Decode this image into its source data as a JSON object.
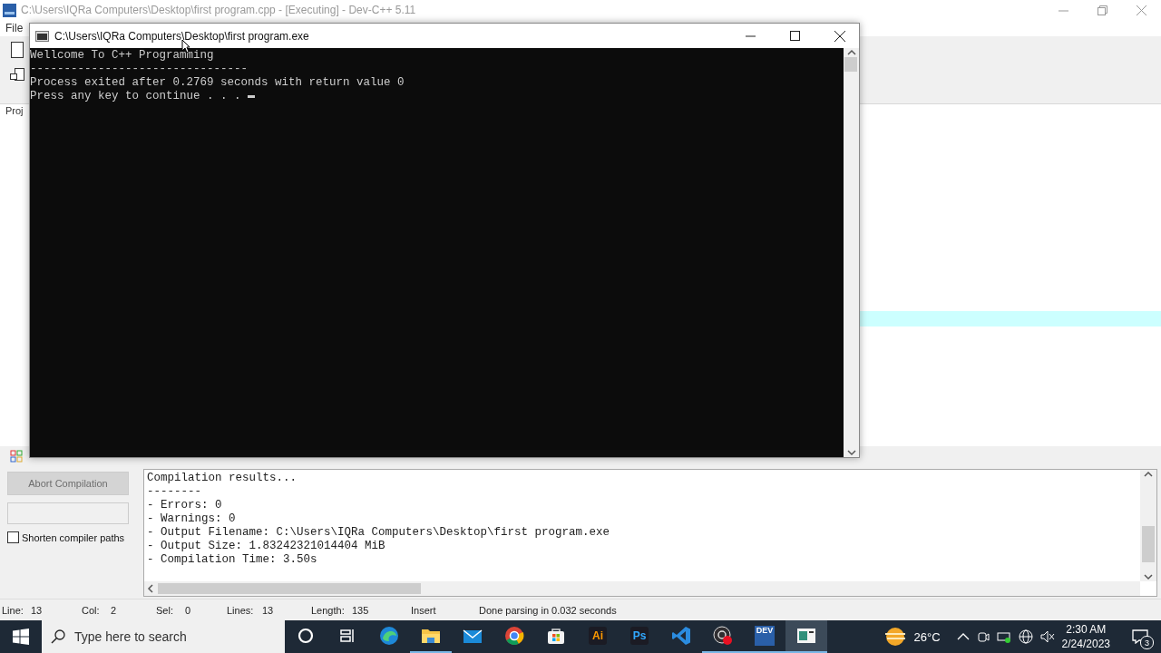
{
  "ide_window": {
    "title": "C:\\Users\\IQRa Computers\\Desktop\\first program.cpp - [Executing] - Dev-C++ 5.11",
    "menu": [
      "File"
    ],
    "project_tab": "Proj"
  },
  "console_window": {
    "title": "C:\\Users\\IQRa Computers\\Desktop\\first program.exe",
    "lines": [
      "Wellcome To C++ Programming",
      "--------------------------------",
      "Process exited after 0.2769 seconds with return value 0",
      "Press any key to continue . . . "
    ],
    "cursor": true
  },
  "compiler_panel": {
    "abort_button": {
      "label": "Abort Compilation",
      "disabled": true
    },
    "shorten_paths": {
      "label": "Shorten compiler paths",
      "checked": false
    },
    "log_lines": [
      "Compilation results...",
      "--------",
      "- Errors: 0",
      "- Warnings: 0",
      "- Output Filename: C:\\Users\\IQRa Computers\\Desktop\\first program.exe",
      "- Output Size: 1.83242321014404 MiB",
      "- Compilation Time: 3.50s"
    ]
  },
  "status_bar": {
    "fields": [
      {
        "label": "Line:",
        "value": "13"
      },
      {
        "label": "Col:",
        "value": "2"
      },
      {
        "label": "Sel:",
        "value": "0"
      },
      {
        "label": "Lines:",
        "value": "13"
      },
      {
        "label": "Length:",
        "value": "135"
      }
    ],
    "mode": "Insert",
    "message": "Done parsing in 0.032 seconds"
  },
  "taskbar": {
    "search": {
      "placeholder": "Type here to search"
    },
    "apps": [
      {
        "kind": "cortana",
        "running": false,
        "selected": false
      },
      {
        "kind": "task-view",
        "running": false,
        "selected": false
      },
      {
        "kind": "edge",
        "running": false,
        "selected": false
      },
      {
        "kind": "explorer",
        "running": true,
        "selected": false
      },
      {
        "kind": "mail",
        "running": false,
        "selected": false
      },
      {
        "kind": "chrome",
        "running": false,
        "selected": false
      },
      {
        "kind": "store",
        "running": false,
        "selected": false
      },
      {
        "kind": "letters",
        "label": "Ai",
        "color": "#ff9a00",
        "running": false,
        "selected": false
      },
      {
        "kind": "letters",
        "label": "Ps",
        "color": "#31a8ff",
        "running": false,
        "selected": false
      },
      {
        "kind": "vscode",
        "running": false,
        "selected": false
      },
      {
        "kind": "obs",
        "running": true,
        "selected": false
      },
      {
        "kind": "dev",
        "label": "DEV",
        "running": true,
        "selected": false
      },
      {
        "kind": "console",
        "running": true,
        "selected": true
      }
    ],
    "weather": "26°C",
    "time": "2:30 AM",
    "date": "2/24/2023",
    "notifications": "3"
  }
}
